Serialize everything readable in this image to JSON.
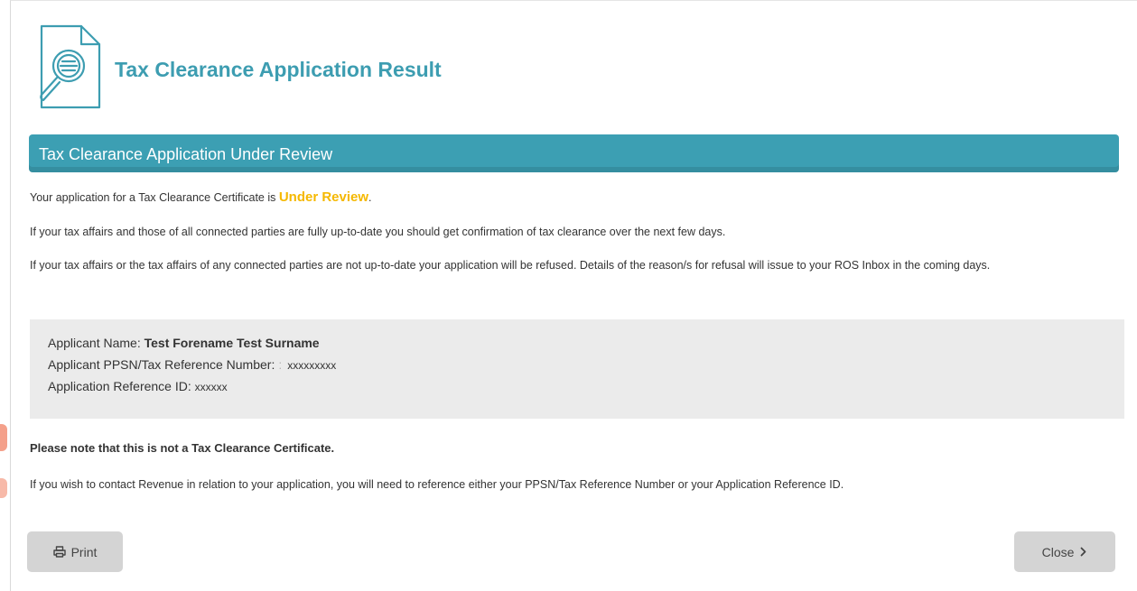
{
  "header": {
    "title": "Tax Clearance Application Result",
    "icon": "document-search-icon"
  },
  "status_bar": {
    "label": "Tax Clearance Application Under Review"
  },
  "messages": {
    "status_prefix": "Your application for a Tax Clearance Certificate is ",
    "status_value": "Under Review",
    "status_suffix": ".",
    "up_to_date": "If your tax affairs and those of all connected parties are fully up-to-date you should get confirmation of tax clearance over the next few days.",
    "not_up_to_date": "If your tax affairs or the tax affairs of any connected parties are not up-to-date your application will be refused. Details of the reason/s for refusal will issue to your ROS Inbox in the coming days."
  },
  "applicant": {
    "name_label": "Applicant Name:",
    "name_value": "Test Forename Test Surname",
    "ppsn_label": "Applicant PPSN/Tax Reference Number:",
    "ppsn_sep": ":",
    "ppsn_value": "xxxxxxxxx",
    "ref_label": "Application Reference ID:",
    "ref_value": "xxxxxx"
  },
  "notes": {
    "not_certificate": "Please note that this is not a Tax Clearance Certificate.",
    "contact": "If you wish to contact Revenue in relation to your application, you will need to reference either your PPSN/Tax Reference Number or your Application Reference ID."
  },
  "actions": {
    "print_label": "Print",
    "close_label": "Close"
  },
  "colors": {
    "accent": "#3c9fb3",
    "status": "#f5b800",
    "button": "#d4d4d4",
    "details_bg": "#ebebeb"
  }
}
